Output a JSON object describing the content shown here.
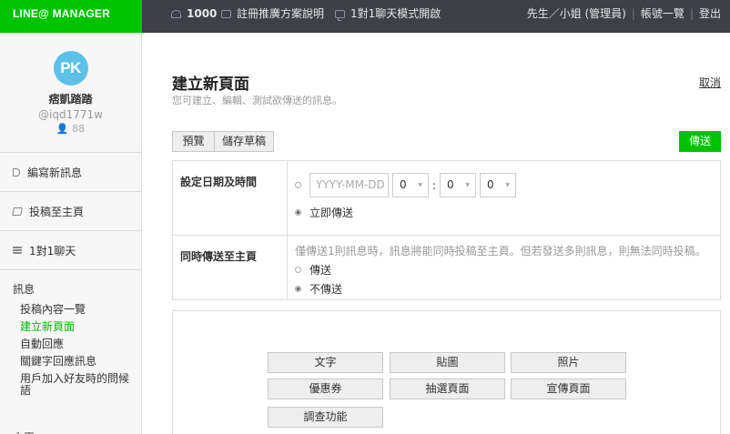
{
  "brand": "LINE@ MANAGER",
  "topbar": {
    "friends_count": "1000",
    "ad_plan_link": "註冊推廣方案說明",
    "chat_mode_link": "1對1聊天模式開啟",
    "user_label": "先生／小姐 (管理員)",
    "account_list": "帳號一覽",
    "logout": "登出",
    "sep": "|"
  },
  "profile": {
    "avatar_text": "PK",
    "name": "痞凱踏踏",
    "id": "@iqd1771w",
    "fans": "88"
  },
  "nav": {
    "compose": "編寫新訊息",
    "post": "投稿至主頁",
    "chat": "1對1聊天"
  },
  "section_message": {
    "title": "訊息",
    "items": [
      "投稿內容一覽",
      "建立新頁面",
      "自動回應",
      "關鍵字回應訊息",
      "用戶加入好友時的問候語"
    ]
  },
  "section_home": {
    "title": "主頁"
  },
  "page": {
    "title": "建立新頁面",
    "subtitle": "您可建立、編輯、測試欲傳送的訊息。",
    "cancel": "取消",
    "preview": "預覽",
    "save_draft": "儲存草稿",
    "send": "傳送"
  },
  "form": {
    "schedule_label": "設定日期及時間",
    "date_placeholder": "YYYY-MM-DD",
    "hour": "0",
    "minute": "0",
    "second": "0",
    "colon": ":",
    "send_now": "立即傳送",
    "post_label": "同時傳送至主頁",
    "post_hint": "僅傳送1則訊息時，訊息將能同時投稿至主頁。但若發送多則訊息，則無法同時投稿。",
    "post_yes": "傳送",
    "post_no": "不傳送"
  },
  "compose_buttons": [
    "文字",
    "貼圖",
    "照片",
    "優惠券",
    "抽選頁面",
    "宣傳頁面",
    "調查功能"
  ]
}
